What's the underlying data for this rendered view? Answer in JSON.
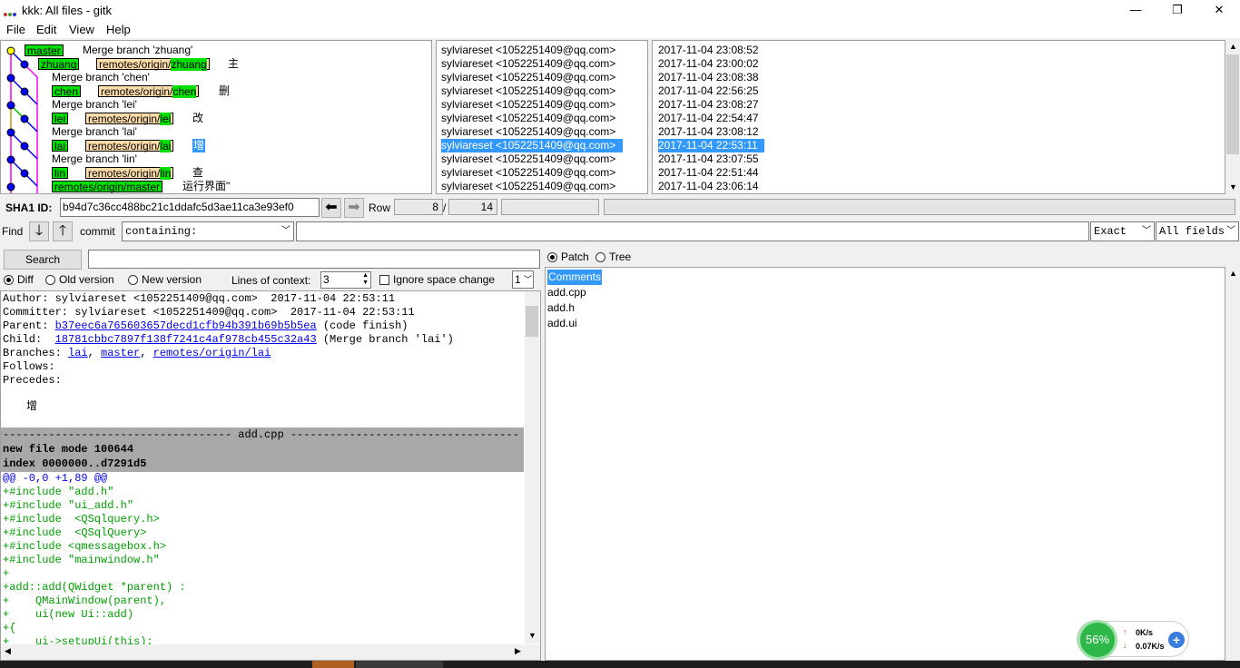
{
  "window": {
    "title": "kkk: All files - gitk"
  },
  "menu": [
    "File",
    "Edit",
    "View",
    "Help"
  ],
  "commits": [
    {
      "refs": [
        {
          "name": "master",
          "kind": "local"
        }
      ],
      "subject": "Merge branch 'zhuang'",
      "author": "sylviareset <1052251409@qq.com>",
      "date": "2017-11-04 23:08:52"
    },
    {
      "refs": [
        {
          "name": "zhuang",
          "kind": "local"
        },
        {
          "name": "zhuang",
          "kind": "remote"
        }
      ],
      "subject": "主",
      "author": "sylviareset <1052251409@qq.com>",
      "date": "2017-11-04 23:00:02"
    },
    {
      "refs": [],
      "subject": "Merge branch 'chen'",
      "author": "sylviareset <1052251409@qq.com>",
      "date": "2017-11-04 23:08:38"
    },
    {
      "refs": [
        {
          "name": "chen",
          "kind": "local"
        },
        {
          "name": "chen",
          "kind": "remote"
        }
      ],
      "subject": "删",
      "author": "sylviareset <1052251409@qq.com>",
      "date": "2017-11-04 22:56:25"
    },
    {
      "refs": [],
      "subject": "Merge branch 'lei'",
      "author": "sylviareset <1052251409@qq.com>",
      "date": "2017-11-04 23:08:27"
    },
    {
      "refs": [
        {
          "name": "lei",
          "kind": "local"
        },
        {
          "name": "lei",
          "kind": "remote"
        }
      ],
      "subject": "改",
      "author": "sylviareset <1052251409@qq.com>",
      "date": "2017-11-04 22:54:47"
    },
    {
      "refs": [],
      "subject": "Merge branch 'lai'",
      "author": "sylviareset <1052251409@qq.com>",
      "date": "2017-11-04 23:08:12"
    },
    {
      "refs": [
        {
          "name": "lai",
          "kind": "local"
        },
        {
          "name": "lai",
          "kind": "remote"
        }
      ],
      "subject": "增",
      "author": "sylviareset <1052251409@qq.com>",
      "date": "2017-11-04 22:53:11",
      "selected": true
    },
    {
      "refs": [],
      "subject": "Merge branch 'lin'",
      "author": "sylviareset <1052251409@qq.com>",
      "date": "2017-11-04 23:07:55"
    },
    {
      "refs": [
        {
          "name": "lin",
          "kind": "local"
        },
        {
          "name": "lin",
          "kind": "remote"
        }
      ],
      "subject": "查",
      "author": "sylviareset <1052251409@qq.com>",
      "date": "2017-11-04 22:51:44"
    },
    {
      "refs": [
        {
          "name": "master",
          "kind": "remote"
        }
      ],
      "subject": "运行界面\"",
      "author": "sylviareset <1052251409@qq.com>",
      "date": "2017-11-04 23:06:14"
    }
  ],
  "remote_prefix": "remotes/origin/",
  "sha": {
    "label": "SHA1 ID:",
    "value": "b94d7c36cc488bc21c1ddafc5d3ae11ca3e93ef0"
  },
  "row": {
    "label": "Row",
    "current": "8",
    "separator": "/",
    "total": "14"
  },
  "find": {
    "label": "Find",
    "type_label": "commit",
    "mode": "containing:",
    "match": "Exact",
    "fields": "All fields"
  },
  "search": {
    "button": "Search"
  },
  "diff_options": {
    "diff": "Diff",
    "old": "Old version",
    "new": "New version",
    "context_label": "Lines of context:",
    "context_value": "3",
    "ignore_space": "Ignore space change",
    "encoding": "1"
  },
  "view_options": {
    "patch": "Patch",
    "tree": "Tree"
  },
  "details": {
    "author": "Author: sylviareset <1052251409@qq.com>  2017-11-04 22:53:11",
    "committer": "Committer: sylviareset <1052251409@qq.com>  2017-11-04 22:53:11",
    "parent_label": "Parent: ",
    "parent_sha": "b37eec6a765603657decd1cfb94b391b69b5b5ea",
    "parent_msg": " (code finish)",
    "child_label": "Child:  ",
    "child_sha": "18781cbbc7897f138f7241c4af978cb455c32a43",
    "child_msg": " (Merge branch 'lai')",
    "branches_label": "Branches: ",
    "branches": [
      "lai",
      "master",
      "remotes/origin/lai"
    ],
    "follows": "Follows:",
    "precedes": "Precedes:",
    "message": "增"
  },
  "diff": {
    "file_header": "----------------------------------- add.cpp -----------------------------------",
    "mode": "new file mode 100644",
    "index": "index 0000000..d7291d5",
    "hunk": "@@ -0,0 +1,89 @@",
    "lines": [
      "+#include \"add.h\"",
      "+#include \"ui_add.h\"",
      "+#include  <QSqlquery.h>",
      "+#include  <QSqlQuery>",
      "+#include <qmessagebox.h>",
      "+#include \"mainwindow.h\"",
      "+",
      "+add::add(QWidget *parent) :",
      "+    QMainWindow(parent),",
      "+    ui(new Ui::add)",
      "+{",
      "+    ui->setupUi(this);"
    ]
  },
  "files": [
    "Comments",
    "add.cpp",
    "add.h",
    "add.ui"
  ],
  "net_widget": {
    "percent": "56%",
    "up": "0K/s",
    "down": "0.07K/s"
  }
}
